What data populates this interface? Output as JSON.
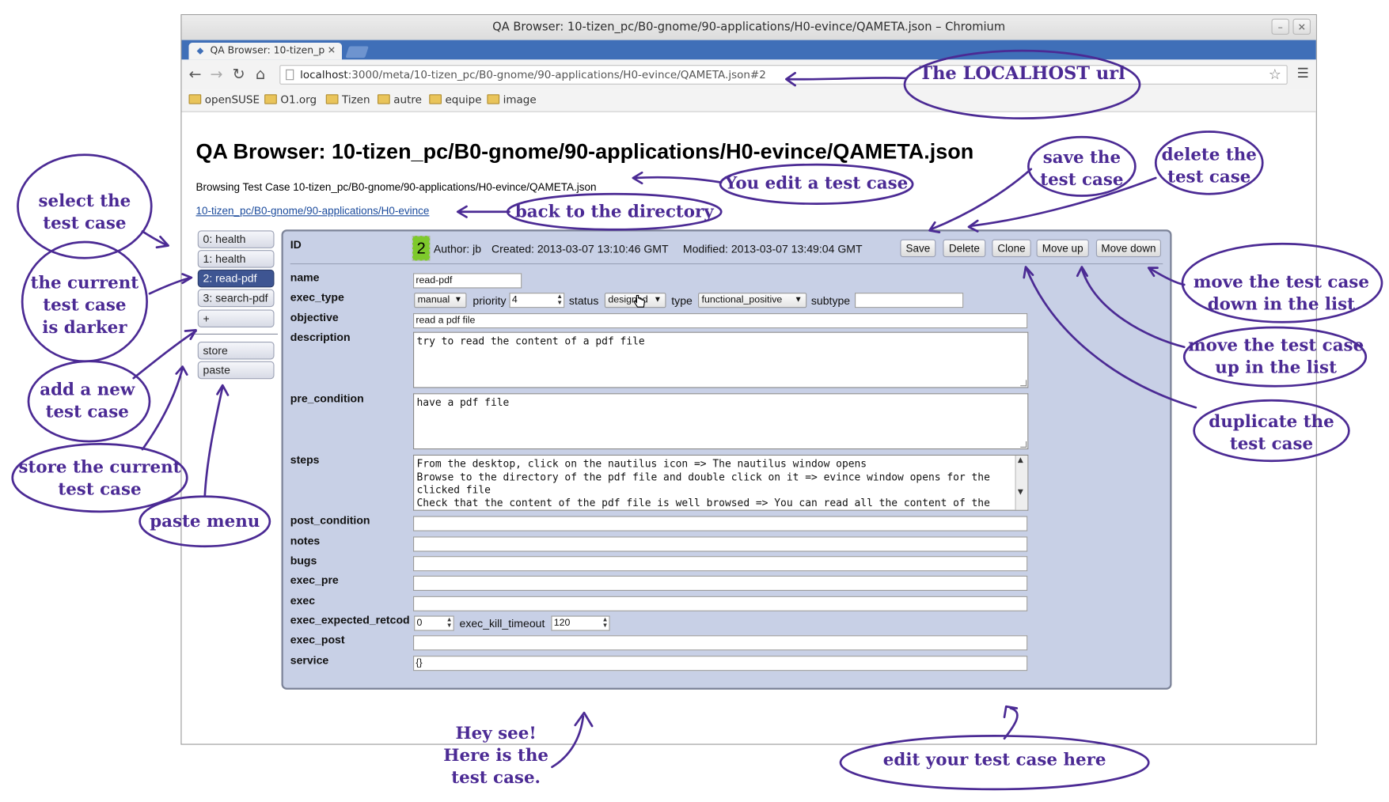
{
  "window": {
    "title": "QA Browser: 10-tizen_pc/B0-gnome/90-applications/H0-evince/QAMETA.json – Chromium",
    "tab_title": "QA Browser: 10-tizen_p",
    "url_host": "localhost",
    "url_rest": ":3000/meta/10-tizen_pc/B0-gnome/90-applications/H0-evince/QAMETA.json#2",
    "bookmarks": [
      "openSUSE",
      "O1.org",
      "Tizen",
      "autre",
      "equipe",
      "image"
    ]
  },
  "page": {
    "heading": "QA Browser: 10-tizen_pc/B0-gnome/90-applications/H0-evince/QAMETA.json",
    "browsing": "Browsing Test Case 10-tizen_pc/B0-gnome/90-applications/H0-evince/QAMETA.json",
    "back_link": "10-tizen_pc/B0-gnome/90-applications/H0-evince"
  },
  "sidebar": {
    "items": [
      "0: health",
      "1: health",
      "2: read-pdf",
      "3: search-pdf",
      "+"
    ],
    "active_index": 2,
    "actions": [
      "store",
      "paste"
    ]
  },
  "testcase": {
    "id_label": "ID",
    "id": "2",
    "author": "Author: jb",
    "created": "Created: 2013-03-07 13:10:46 GMT",
    "modified": "Modified: 2013-03-07 13:49:04 GMT",
    "buttons": [
      "Save",
      "Delete",
      "Clone",
      "Move up",
      "Move down"
    ],
    "labels": {
      "name": "name",
      "exec_type": "exec_type",
      "objective": "objective",
      "description": "description",
      "pre_condition": "pre_condition",
      "steps": "steps",
      "post_condition": "post_condition",
      "notes": "notes",
      "bugs": "bugs",
      "exec_pre": "exec_pre",
      "exec": "exec",
      "exec_expected_retcode": "exec_expected_retcod",
      "exec_post": "exec_post",
      "service": "service",
      "priority": "priority",
      "status": "status",
      "type": "type",
      "subtype": "subtype",
      "exec_kill_timeout": "exec_kill_timeout"
    },
    "name": "read-pdf",
    "exec_type": "manual",
    "priority": "4",
    "status": "designed",
    "type": "functional_positive",
    "subtype": "",
    "objective": "read a pdf file",
    "description": "try to read the content of a pdf file",
    "pre_condition": "have a pdf file",
    "steps": "From the desktop, click on the nautilus icon => The nautilus window opens\nBrowse to the directory of the pdf file and double click on it => evince window opens for the\nclicked file\nCheck that the content of the pdf file is well browsed => You can read all the content of the",
    "post_condition": "",
    "notes": "",
    "bugs": "",
    "exec_pre": "",
    "exec": "",
    "exec_expected_retcode": "0",
    "exec_kill_timeout": "120",
    "exec_post": "",
    "service": "{}"
  },
  "annotations": {
    "localhost_url": "The LOCALHOST url",
    "select_test_case": "select the\ntest case",
    "current_darker": "the current\ntest case\nis darker",
    "add_new": "add a new\ntest case",
    "store_current": "store the current\ntest case",
    "paste_menu": "paste menu",
    "edit_test_case": "You edit a test case",
    "back_directory": "back to the directory",
    "save": "save the\ntest case",
    "delete": "delete the\ntest case",
    "move_down": "move the test case\ndown in the list",
    "move_up": "move the test case\nup in the list",
    "duplicate": "duplicate the\ntest case",
    "hey_see": "Hey see!\nHere is the\ntest case.",
    "edit_here": "edit your test case here"
  },
  "colors": {
    "annotation_ink": "#4b2a94",
    "panel_bg": "#c8d0e6",
    "active_item": "#3e5592",
    "id_badge": "#7ec92c",
    "tab_strip": "#3f6fb8"
  }
}
